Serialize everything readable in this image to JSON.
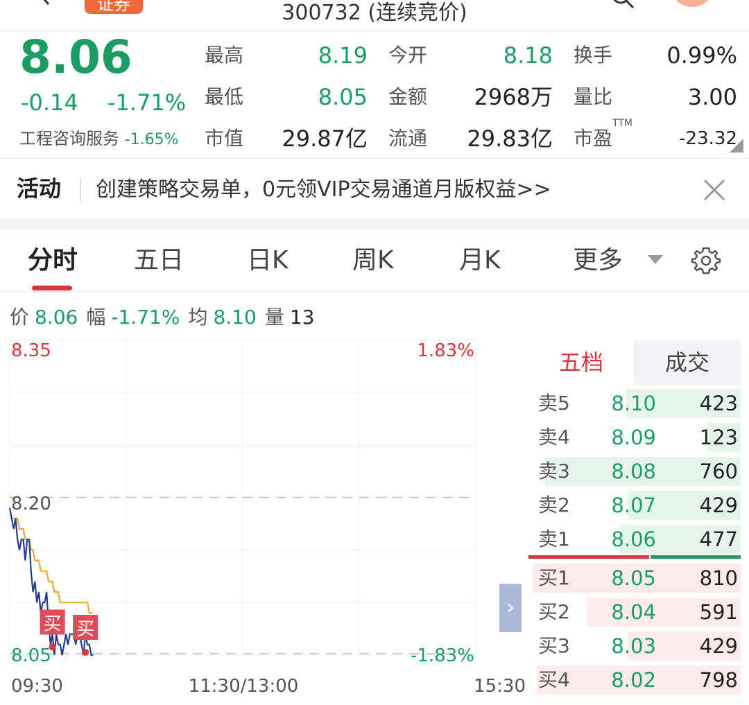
{
  "header": {
    "badge": "证券",
    "subtitle": "300732 (连续竞价)"
  },
  "quote": {
    "price": "8.06",
    "change": "-0.14",
    "change_pct": "-1.71%",
    "sector_name": "工程咨询服务",
    "sector_change": "-1.65%",
    "stats": [
      {
        "label": "最高",
        "value": "8.19",
        "color": "green"
      },
      {
        "label": "今开",
        "value": "8.18",
        "color": "green"
      },
      {
        "label": "换手",
        "value": "0.99%",
        "color": "dark"
      },
      {
        "label": "最低",
        "value": "8.05",
        "color": "green"
      },
      {
        "label": "金额",
        "value": "2968万",
        "color": "dark"
      },
      {
        "label": "量比",
        "value": "3.00",
        "color": "dark"
      },
      {
        "label": "市值",
        "value": "29.87亿",
        "color": "dark"
      },
      {
        "label": "流通",
        "value": "29.83亿",
        "color": "dark"
      },
      {
        "label": "市盈",
        "value": "-23.32",
        "color": "dark"
      }
    ],
    "ttm": "TTM"
  },
  "activity": {
    "label": "活动",
    "text": "创建策略交易单，0元领VIP交易通道月版权益>>"
  },
  "tabs": [
    {
      "label": "分时",
      "active": true
    },
    {
      "label": "五日"
    },
    {
      "label": "日K"
    },
    {
      "label": "周K"
    },
    {
      "label": "月K"
    },
    {
      "label": "更多"
    }
  ],
  "info": {
    "price_label": "价",
    "price": "8.06",
    "amp_label": "幅",
    "amp": "-1.71%",
    "avg_label": "均",
    "avg": "8.10",
    "vol_label": "量",
    "vol": "13"
  },
  "chart_data": {
    "type": "line",
    "y_labels": {
      "top": "8.35",
      "mid": "8.20",
      "bottom": "8.05"
    },
    "pct_labels": {
      "top": "1.83%",
      "bottom": "-1.83%"
    },
    "x_labels": [
      "09:30",
      "11:30/13:00",
      "15:30"
    ],
    "ylim": [
      8.05,
      8.35
    ],
    "reference": 8.2,
    "total_minutes": 240,
    "series": [
      {
        "color": "#233e8b",
        "x": [
          0,
          1,
          2,
          3,
          4,
          5,
          6,
          7,
          8,
          9,
          10,
          11,
          12,
          13,
          14,
          15,
          16,
          17,
          18,
          19,
          20,
          21,
          22,
          23,
          24,
          25,
          26,
          27,
          28,
          29,
          30,
          31,
          32,
          33,
          34,
          35,
          36,
          37,
          38,
          39,
          40,
          41,
          42,
          43
        ],
        "values": [
          8.19,
          8.18,
          8.17,
          8.18,
          8.16,
          8.15,
          8.16,
          8.16,
          8.14,
          8.16,
          8.16,
          8.13,
          8.11,
          8.12,
          8.1,
          8.11,
          8.09,
          8.1,
          8.1,
          8.11,
          8.08,
          8.06,
          8.07,
          8.05,
          8.07,
          8.06,
          8.06,
          8.05,
          8.06,
          8.07,
          8.06,
          8.07,
          8.07,
          8.07,
          8.06,
          8.07,
          8.07,
          8.06,
          8.05,
          8.07,
          8.06,
          8.06,
          8.05,
          8.05
        ]
      },
      {
        "color": "#f0a733",
        "x": [
          0,
          1,
          2,
          3,
          4,
          5,
          6,
          7,
          8,
          9,
          10,
          11,
          12,
          13,
          14,
          15,
          16,
          17,
          18,
          19,
          20,
          21,
          22,
          23,
          24,
          25,
          26,
          27,
          28,
          29,
          30,
          31,
          32,
          33,
          34,
          35,
          36,
          37,
          38,
          39,
          40,
          41,
          42,
          43
        ],
        "values": [
          8.19,
          8.18,
          8.18,
          8.18,
          8.18,
          8.17,
          8.17,
          8.17,
          8.16,
          8.16,
          8.16,
          8.15,
          8.15,
          8.14,
          8.14,
          8.14,
          8.13,
          8.13,
          8.13,
          8.13,
          8.12,
          8.12,
          8.12,
          8.11,
          8.11,
          8.11,
          8.1,
          8.1,
          8.1,
          8.1,
          8.1,
          8.1,
          8.1,
          8.1,
          8.1,
          8.1,
          8.1,
          8.1,
          8.1,
          8.1,
          8.1,
          8.09,
          8.09,
          8.09
        ]
      }
    ],
    "markers": [
      {
        "label": "买",
        "x": 22,
        "value": 8.055
      },
      {
        "label": "买",
        "x": 39,
        "value": 8.05
      }
    ]
  },
  "orderbook": {
    "tab_active": "五档",
    "tab_other": "成交",
    "expand": "›",
    "sell": [
      {
        "label": "卖5",
        "price": "8.10",
        "vol": "423",
        "ratio": 0.55
      },
      {
        "label": "卖4",
        "price": "8.09",
        "vol": "123",
        "ratio": 0.16
      },
      {
        "label": "卖3",
        "price": "8.08",
        "vol": "760",
        "ratio": 0.94
      },
      {
        "label": "卖2",
        "price": "8.07",
        "vol": "429",
        "ratio": 0.54
      },
      {
        "label": "卖1",
        "price": "8.06",
        "vol": "477",
        "ratio": 0.58
      }
    ],
    "buy": [
      {
        "label": "买1",
        "price": "8.05",
        "vol": "810",
        "ratio": 1.0
      },
      {
        "label": "买2",
        "price": "8.04",
        "vol": "591",
        "ratio": 0.74
      },
      {
        "label": "买3",
        "price": "8.03",
        "vol": "429",
        "ratio": 0.54
      },
      {
        "label": "买4",
        "price": "8.02",
        "vol": "798",
        "ratio": 0.98
      }
    ]
  },
  "colors": {
    "up": "#d9363e",
    "down": "#1a9d62",
    "sell_bar": "#e6f5ec",
    "buy_bar": "#fdeaea"
  }
}
